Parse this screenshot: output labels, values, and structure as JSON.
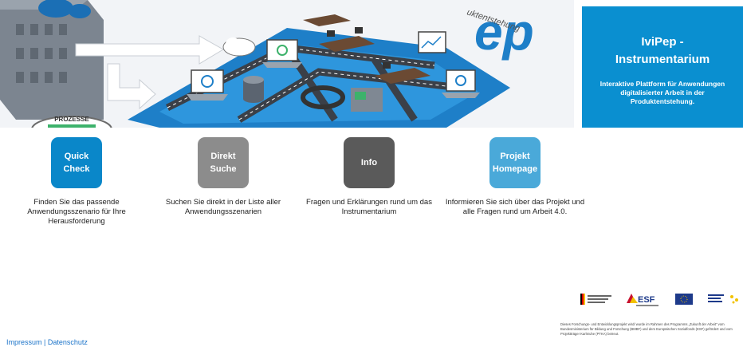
{
  "title_panel": {
    "title_line1": "IviPep -",
    "title_line2": "Instrumentarium",
    "subtitle": "Interaktive Plattform für Anwendungen digitalisierter Arbeit in der Produktentstehung."
  },
  "hero": {
    "banner_fragment": "ep",
    "banner_sub": "uktentstehung",
    "badge": "PROZESSE"
  },
  "tiles": [
    {
      "line1": "Quick",
      "line2": "Check",
      "color": "#0a87c9",
      "description": "Finden Sie das passende Anwendungsszenario für Ihre Herausforderung"
    },
    {
      "line1": "Direkt",
      "line2": "Suche",
      "color": "#8c8c8c",
      "description": "Suchen Sie direkt in der Liste aller Anwendungsszenarien"
    },
    {
      "line1": "Info",
      "line2": "",
      "color": "#5a5a5a",
      "description": "Fragen und Erklärungen rund um das Instrumentarium"
    },
    {
      "line1": "Projekt",
      "line2": "Homepage",
      "color": "#4aa9d9",
      "description": "Informieren Sie sich über das Projekt und alle Fragen rund um Arbeit 4.0."
    }
  ],
  "footer": {
    "impressum": "Impressum",
    "separator": "|",
    "datenschutz": "Datenschutz",
    "logos": [
      "Bundesministerium für Bildung und Forschung",
      "ESF",
      "EU",
      "Zusammen. Zukunft. Gestalten."
    ],
    "funding_text": "Dieses Forschungs- und Entwicklungsprojekt wird/ wurde im Rahmen des Programms „Zukunft der Arbeit\" vom Bundesministerium für Bildung und Forschung (BMBF) und dem Europäischen Sozialfonds (ESF) gefördert und vom Projektträger Karlsruhe (PTKA) betreut."
  }
}
